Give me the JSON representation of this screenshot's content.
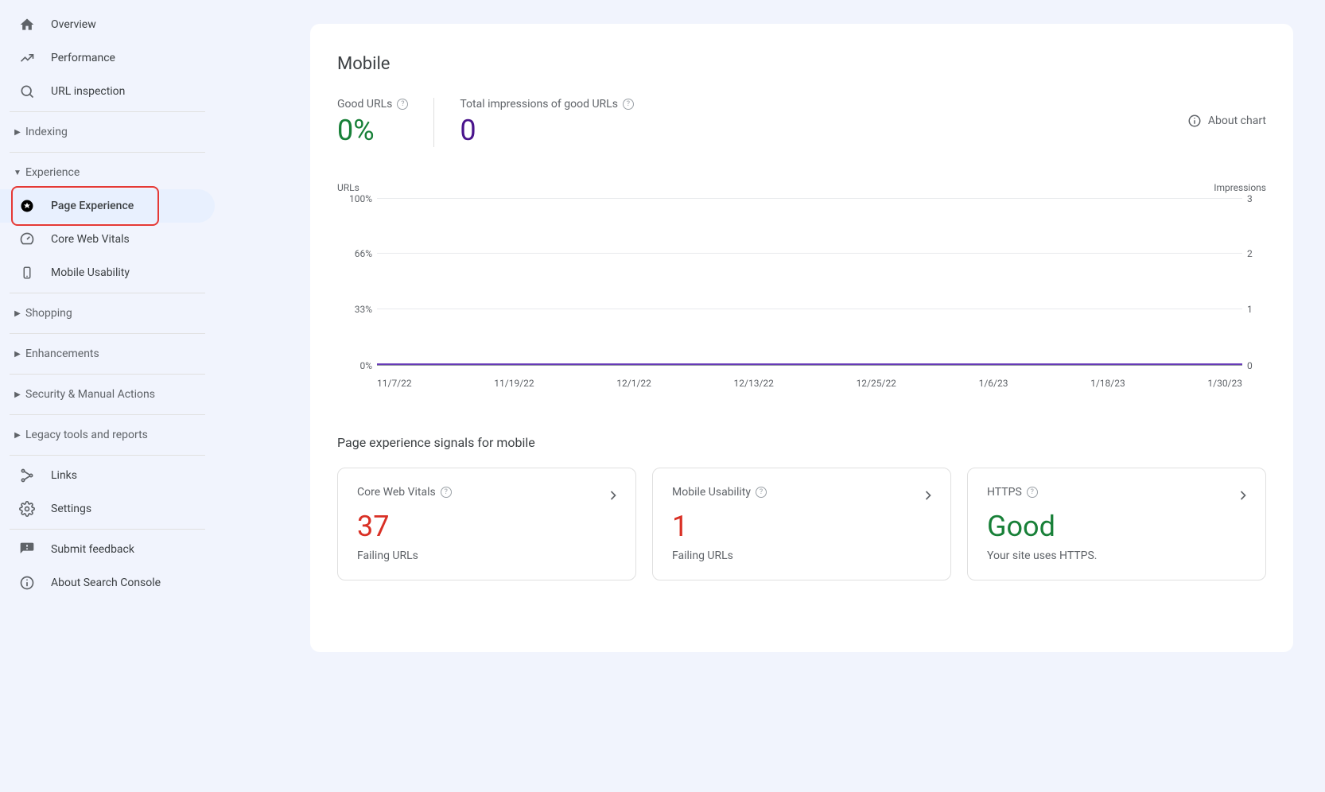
{
  "sidebar": {
    "items": {
      "overview": "Overview",
      "performance": "Performance",
      "url_inspection": "URL inspection",
      "links": "Links",
      "settings": "Settings",
      "submit_feedback": "Submit feedback",
      "about": "About Search Console"
    },
    "sections": {
      "indexing": "Indexing",
      "experience": "Experience",
      "shopping": "Shopping",
      "enhancements": "Enhancements",
      "security": "Security & Manual Actions",
      "legacy": "Legacy tools and reports"
    },
    "experience_children": {
      "page_experience": "Page Experience",
      "core_web_vitals": "Core Web Vitals",
      "mobile_usability": "Mobile Usability"
    }
  },
  "main": {
    "title": "Mobile",
    "about_chart": "About chart",
    "kpi_good_urls": {
      "label": "Good URLs",
      "value": "0%"
    },
    "kpi_impressions": {
      "label": "Total impressions of good URLs",
      "value": "0"
    },
    "signals_title": "Page experience signals for mobile"
  },
  "signals": {
    "cwv": {
      "title": "Core Web Vitals",
      "value": "37",
      "sub": "Failing URLs"
    },
    "musab": {
      "title": "Mobile Usability",
      "value": "1",
      "sub": "Failing URLs"
    },
    "https": {
      "title": "HTTPS",
      "value": "Good",
      "sub": "Your site uses HTTPS."
    }
  },
  "chart_data": {
    "type": "line",
    "title": "",
    "left_axis_label": "URLs",
    "right_axis_label": "Impressions",
    "left_ticks": [
      "100%",
      "66%",
      "33%",
      "0%"
    ],
    "right_ticks": [
      "3",
      "2",
      "1",
      "0"
    ],
    "x_dates": [
      "11/7/22",
      "11/19/22",
      "12/1/22",
      "12/13/22",
      "12/25/22",
      "1/6/23",
      "1/18/23",
      "1/30/23"
    ],
    "series": [
      {
        "name": "Good URL %",
        "values": [
          0,
          0,
          0,
          0,
          0,
          0,
          0,
          0
        ],
        "axis": "left"
      },
      {
        "name": "Impressions",
        "values": [
          0,
          0,
          0,
          0,
          0,
          0,
          0,
          0
        ],
        "axis": "right"
      }
    ],
    "ylim_left": [
      0,
      100
    ],
    "ylim_right": [
      0,
      3
    ]
  }
}
